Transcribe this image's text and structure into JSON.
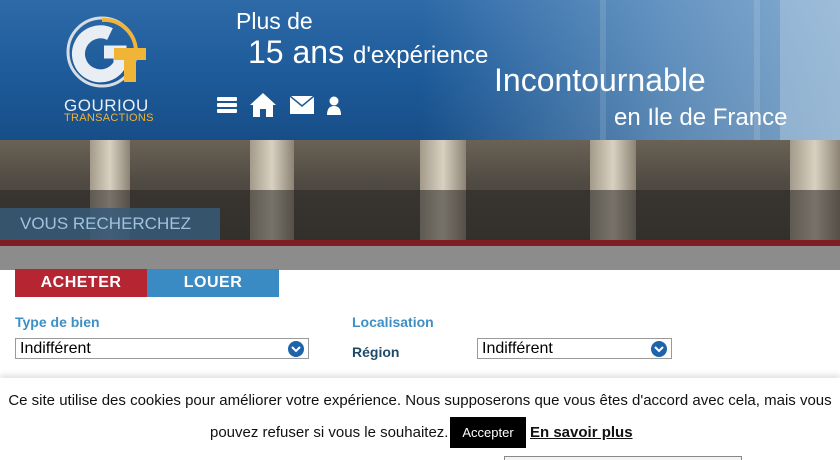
{
  "brand": {
    "name": "GOURIOU",
    "subtitle": "TRANSACTIONS",
    "colors": {
      "blue": "#1d5a99",
      "gold": "#f0b436",
      "silver": "#d8dde3"
    }
  },
  "tagline": {
    "line1": "Plus de",
    "line2_big": "15 ans",
    "line2_small": "d'expérience",
    "line3": "Incontournable",
    "line4": "en Ile de France"
  },
  "nav_icons": [
    "menu-icon",
    "home-icon",
    "mail-icon",
    "user-icon"
  ],
  "banner": {
    "search_label": "VOUS RECHERCHEZ"
  },
  "tabs": [
    {
      "label": "ACHETER",
      "active": true,
      "color": "#b62532"
    },
    {
      "label": "LOUER",
      "active": false,
      "color": "#3a8bc4"
    }
  ],
  "form": {
    "type_label": "Type de bien",
    "type_value": "Indifférent",
    "location_label": "Localisation",
    "region_label": "Région",
    "region_value": "Indifférent"
  },
  "cookie": {
    "text_line1": "Ce site utilise des cookies pour améliorer votre expérience. Nous supposerons que vous êtes d'accord avec cela, mais vous",
    "text_line2": "pouvez refuser si vous le souhaitez.",
    "accept_label": "Accepter",
    "more_label": "En savoir plus"
  }
}
